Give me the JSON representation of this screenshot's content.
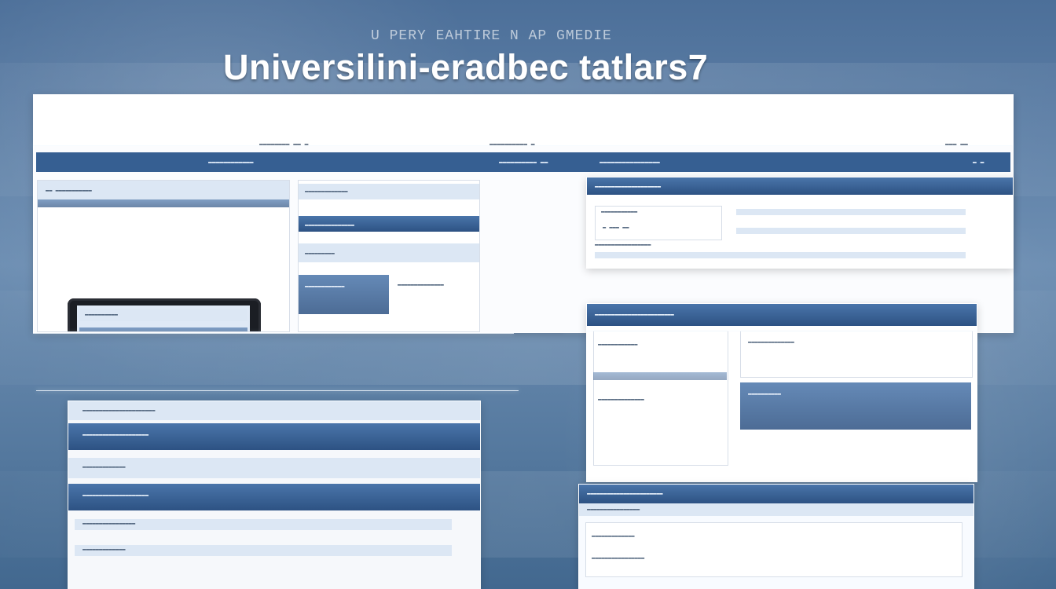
{
  "header": {
    "brand_line": "U PERY EAHTIRE N AP GMEDIE",
    "headline": "Universilini-eradbec tatlars7"
  },
  "top_window": {
    "top_texts": [
      "▬▬▬▬▬▬▬▬ ▬▬ ▬",
      "▬▬▬▬▬▬▬▬▬▬ ▬",
      "▬▬▬ ▬▬"
    ],
    "nav_texts": [
      "▬▬▬▬▬▬▬▬▬▬▬▬",
      "▬▬▬▬▬▬▬▬▬▬ ▬▬",
      "▬▬▬▬▬▬▬▬▬▬▬▬▬▬▬▬",
      "▬ ▬"
    ]
  },
  "left_panel": {
    "title": "▬▬ ▬▬▬▬▬▬▬▬▬▬▬",
    "monitor_rows": [
      "▬▬▬▬▬▬▬▬▬▬",
      "▬▬▬▬▬▬▬▬▬",
      "▬▬▬▬▬▬▬▬",
      "▬▬▬▬▬▬▬"
    ]
  },
  "center_panel": {
    "rows": [
      "▬▬▬▬▬▬▬▬▬▬▬▬▬",
      "▬▬▬▬▬▬▬▬▬▬▬▬▬▬▬",
      "▬▬▬▬▬▬▬▬▬",
      "▬▬▬▬▬▬▬▬▬▬▬▬",
      "▬▬▬▬▬▬▬▬▬▬▬▬▬▬"
    ]
  },
  "right_a": {
    "rows": [
      "▬▬▬▬▬▬▬▬▬▬▬▬▬▬▬▬▬▬▬▬",
      "▬▬▬▬▬▬▬▬▬▬▬",
      "▬ ▬▬▬ ▬▬",
      "▬▬▬▬▬▬▬▬▬▬▬▬▬▬▬▬▬"
    ]
  },
  "right_b": {
    "rows": [
      "▬▬▬▬▬▬▬▬▬▬▬▬▬▬▬▬▬▬▬▬▬▬▬▬",
      "▬▬▬▬▬▬▬▬▬▬▬▬",
      "▬▬▬▬▬▬▬▬▬▬▬▬▬▬",
      "▬▬▬▬▬▬▬▬▬▬▬▬▬▬",
      "▬▬▬▬▬▬▬▬▬▬"
    ]
  },
  "bottom_left": {
    "rows": [
      "▬▬▬▬▬▬▬▬▬▬▬▬▬▬▬▬▬▬▬▬▬▬",
      "▬▬▬▬▬▬▬▬▬▬▬▬▬▬▬▬▬▬▬▬",
      "▬▬▬▬▬▬▬▬▬▬▬▬▬",
      "▬▬▬▬▬▬▬▬▬▬▬▬▬▬▬▬▬▬▬▬",
      "▬▬▬▬▬▬▬▬▬▬▬▬▬▬▬▬",
      "▬▬▬▬▬▬▬▬▬▬▬▬▬"
    ]
  },
  "right_c": {
    "rows": [
      "▬▬▬▬▬▬▬▬▬▬▬▬▬▬▬▬▬▬▬▬▬▬▬",
      "▬▬▬▬▬▬▬▬▬▬▬▬▬▬▬▬",
      "▬▬▬▬▬▬▬▬▬▬▬▬▬",
      "▬▬▬▬▬▬▬▬▬▬▬▬▬▬▬▬"
    ]
  }
}
